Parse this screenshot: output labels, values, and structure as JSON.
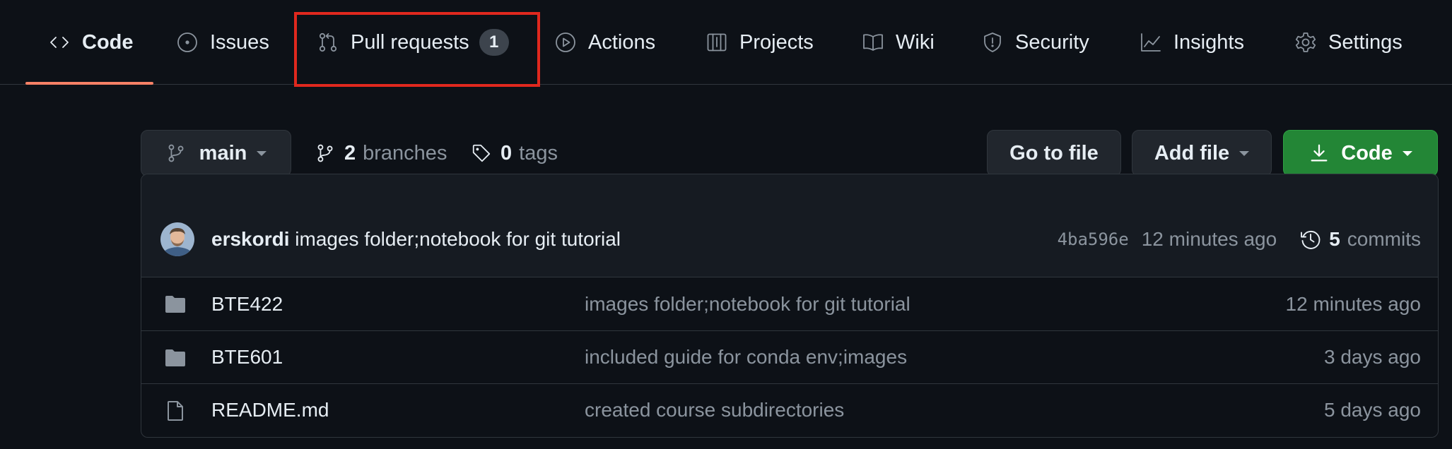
{
  "repo_nav": {
    "tabs": [
      {
        "label": "Code",
        "icon": "code-icon",
        "selected": true
      },
      {
        "label": "Issues",
        "icon": "issue-opened-icon"
      },
      {
        "label": "Pull requests",
        "icon": "git-pull-request-icon",
        "counter": "1",
        "highlighted": true
      },
      {
        "label": "Actions",
        "icon": "play-icon"
      },
      {
        "label": "Projects",
        "icon": "table-icon"
      },
      {
        "label": "Wiki",
        "icon": "book-icon"
      },
      {
        "label": "Security",
        "icon": "shield-icon"
      },
      {
        "label": "Insights",
        "icon": "graph-icon"
      },
      {
        "label": "Settings",
        "icon": "gear-icon"
      }
    ],
    "underline_color": "#f78166",
    "highlight_color": "#e0281e"
  },
  "branch_bar": {
    "branch_name": "main",
    "branches_count": "2",
    "branches_label": "branches",
    "tags_count": "0",
    "tags_label": "tags",
    "go_to_file_label": "Go to file",
    "add_file_label": "Add file",
    "code_label": "Code",
    "code_button_color": "#238636"
  },
  "latest_commit": {
    "author": "erskordi",
    "message": "images folder;notebook for git tutorial",
    "sha": "4ba596e",
    "time": "12 minutes ago",
    "commits_count": "5",
    "commits_label": "commits"
  },
  "files": [
    {
      "type": "folder",
      "icon": "file-directory-icon",
      "name": "BTE422",
      "message": "images folder;notebook for git tutorial",
      "age": "12 minutes ago"
    },
    {
      "type": "folder",
      "icon": "file-directory-icon",
      "name": "BTE601",
      "message": "included guide for conda env;images",
      "age": "3 days ago"
    },
    {
      "type": "file",
      "icon": "file-icon",
      "name": "README.md",
      "message": "created course subdirectories",
      "age": "5 days ago"
    }
  ]
}
